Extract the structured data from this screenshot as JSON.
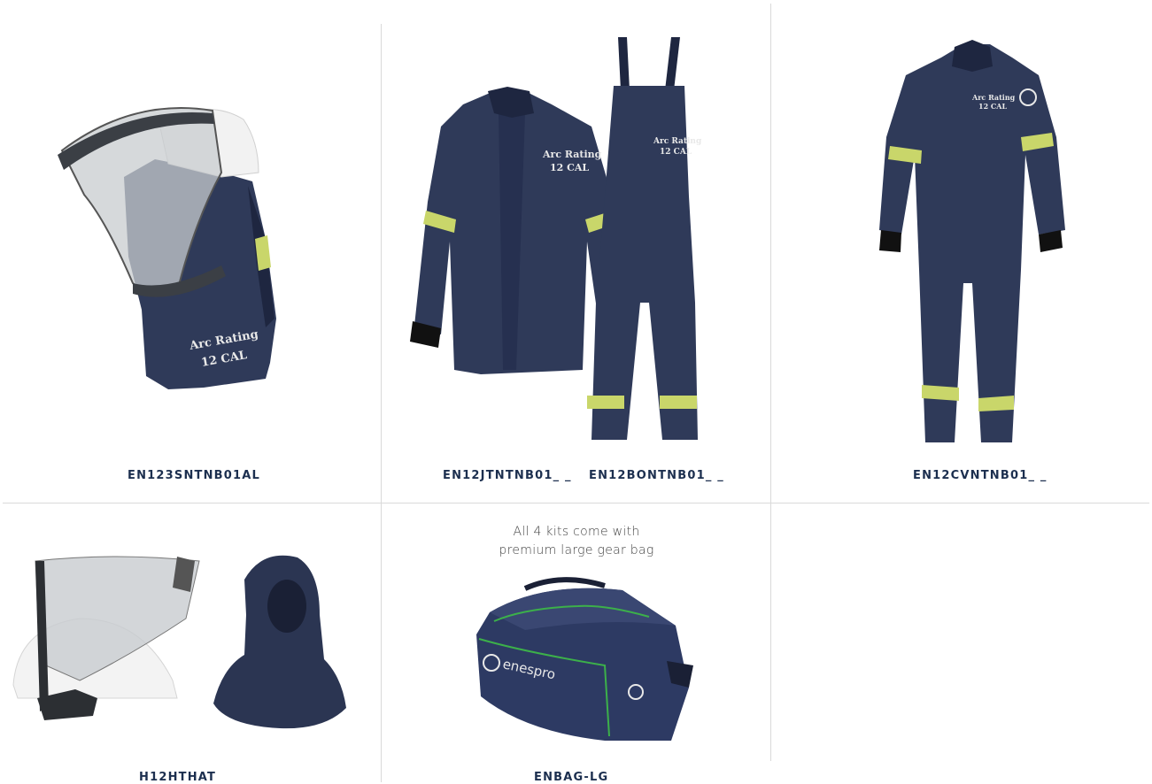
{
  "products": {
    "hood_kit_sku": "EN123SNTNB01AL",
    "jacket_sku": "EN12JTNTNB01_ _",
    "bib_sku": "EN12BONTNB01_ _",
    "coverall_sku": "EN12CVNTNB01_ _",
    "hardhat_sku": "H12HTHAT",
    "bag_sku": "ENBAG-LG"
  },
  "bag_caption": {
    "line1": "All 4 kits come with",
    "line2": "premium large gear bag"
  },
  "garment_labels": {
    "line1": "Arc Rating",
    "line2": "12 CAL"
  },
  "brand": "enespro",
  "colors": {
    "navy": "#2b3552",
    "navy_dark": "#1e2640",
    "reflective": "#c9d66a",
    "sku_text": "#1c2f4f",
    "grid": "#d9d9d9"
  },
  "icons": [
    "arc-hood-image",
    "jacket-image",
    "bib-overall-image",
    "coverall-image",
    "hardhat-faceshield-image",
    "balaclava-image",
    "gear-bag-image"
  ]
}
